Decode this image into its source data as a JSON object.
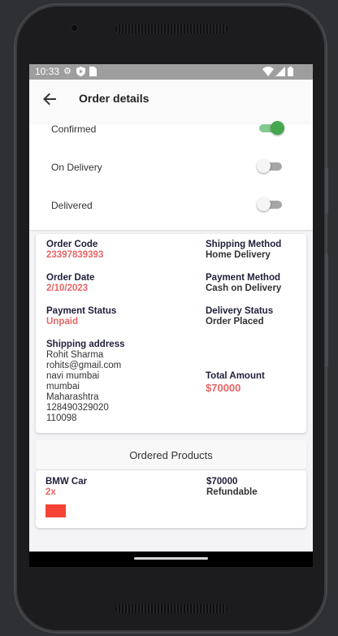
{
  "status_bar": {
    "time": "10:33",
    "left_icons": [
      "gear-icon",
      "shield-icon",
      "sim-icon"
    ],
    "right_icons": [
      "wifi-icon",
      "signal-icon",
      "battery-icon"
    ]
  },
  "app_bar": {
    "title": "Order details"
  },
  "order_status": {
    "rows": [
      {
        "label": "Confirmed",
        "on": true
      },
      {
        "label": "On Delivery",
        "on": false
      },
      {
        "label": "Delivered",
        "on": false
      }
    ]
  },
  "details": {
    "order_code_label": "Order Code",
    "order_code": "23397839393",
    "shipping_method_label": "Shipping Method",
    "shipping_method": "Home Delivery",
    "order_date_label": "Order Date",
    "order_date": "2/10/2023",
    "payment_method_label": "Payment Method",
    "payment_method": "Cash on Delivery",
    "payment_status_label": "Payment Status",
    "payment_status": "Unpaid",
    "delivery_status_label": "Delivery Status",
    "delivery_status": "Order Placed",
    "shipping_address_label": "Shipping address",
    "address_lines": [
      "Rohit Sharma",
      "rohits@gmail.com",
      "navi mumbai",
      "mumbai",
      "Maharashtra",
      "128490329020",
      "110098"
    ],
    "total_amount_label": "Total Amount",
    "total_amount": "$70000"
  },
  "products": {
    "title": "Ordered Products",
    "items": [
      {
        "name": "BMW Car",
        "quantity": "2x",
        "price": "$70000",
        "policy": "Refundable",
        "color": "#f44336"
      }
    ]
  },
  "colors": {
    "accent_red": "#e76565",
    "switch_on": "#45a84f",
    "status_bar": "#9e9e9e"
  }
}
